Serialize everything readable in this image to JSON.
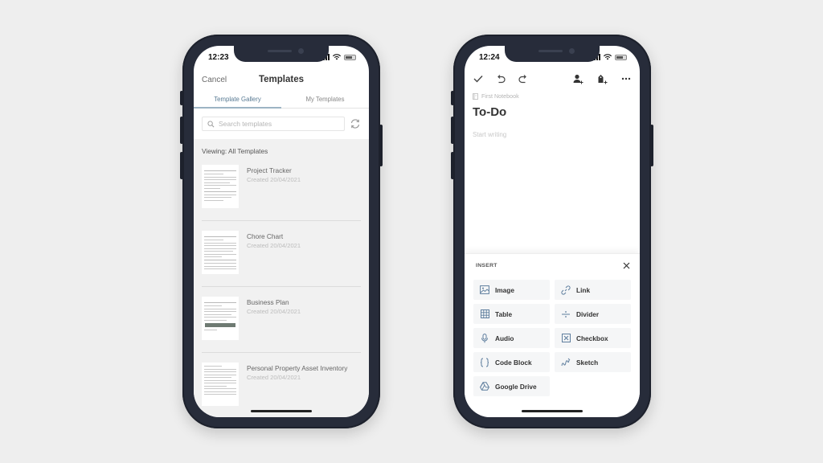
{
  "left_phone": {
    "status": {
      "time": "12:23"
    },
    "header": {
      "cancel_label": "Cancel",
      "title": "Templates"
    },
    "tabs": [
      {
        "label": "Template Gallery",
        "active": true
      },
      {
        "label": "My Templates",
        "active": false
      }
    ],
    "search": {
      "placeholder": "Search templates",
      "icon": "search-icon",
      "refresh_icon": "refresh-icon"
    },
    "viewing_label": "Viewing: All Templates",
    "templates": [
      {
        "name": "Project Tracker",
        "created": "Created 20/04/2021"
      },
      {
        "name": "Chore Chart",
        "created": "Created 20/04/2021"
      },
      {
        "name": "Business Plan",
        "created": "Created 20/04/2021"
      },
      {
        "name": "Personal Property Asset Inventory",
        "created": "Created 20/04/2021"
      }
    ]
  },
  "right_phone": {
    "status": {
      "time": "12:24"
    },
    "toolbar": {
      "left_icons": [
        "check-icon",
        "undo-icon",
        "redo-icon"
      ],
      "right_icons": [
        "share-user-icon",
        "tag-add-icon",
        "more-icon"
      ]
    },
    "notebook": "First Notebook",
    "note_title": "To-Do",
    "body_placeholder": "Start writing",
    "insert": {
      "label": "INSERT",
      "close_icon": "close-icon",
      "items": [
        {
          "label": "Image",
          "icon": "image-icon"
        },
        {
          "label": "Link",
          "icon": "link-icon"
        },
        {
          "label": "Table",
          "icon": "table-icon"
        },
        {
          "label": "Divider",
          "icon": "divider-icon"
        },
        {
          "label": "Audio",
          "icon": "microphone-icon"
        },
        {
          "label": "Checkbox",
          "icon": "checkbox-icon"
        },
        {
          "label": "Code Block",
          "icon": "code-block-icon"
        },
        {
          "label": "Sketch",
          "icon": "sketch-icon"
        },
        {
          "label": "Google Drive",
          "icon": "google-drive-icon"
        }
      ]
    }
  },
  "colors": {
    "background": "#eeeeee",
    "phone_frame": "#272c3a",
    "tab_active": "#587a93",
    "insert_icon": "#5d7d9d",
    "list_bg": "#f1f1f1"
  }
}
